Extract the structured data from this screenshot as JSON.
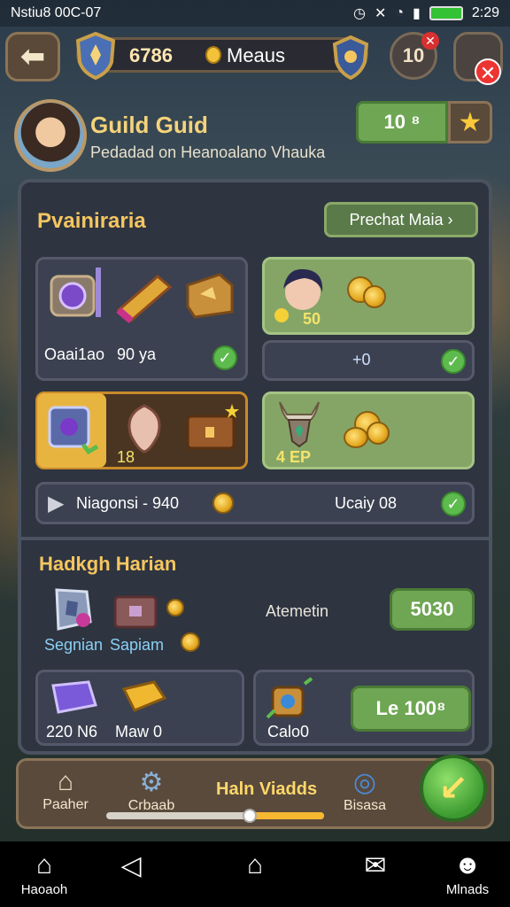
{
  "status_bar": {
    "left_text": "Nstiu8 00C-07",
    "time": "2:29"
  },
  "topbar": {
    "resource_value": "6786",
    "resource_label": "Meaus",
    "level_value": "10"
  },
  "guild": {
    "title": "Guild Guid",
    "subtitle": "Pedadad on Heanoalano Vhauka",
    "amount": "10 ⁸",
    "star_icon": "star-icon"
  },
  "section1": {
    "title": "Pvainiraria",
    "action_button": "Prechat Maia ›",
    "card1": {
      "text_left": "Oaai1ao",
      "text_right": "90 ya"
    },
    "card2": {
      "value": "50"
    },
    "card2b": {
      "value": "+0"
    },
    "card3": {
      "value": "18"
    },
    "card4": {
      "value": "4  EP"
    },
    "row": {
      "label": "Niagonsi - 940",
      "right_text": "Ucaiy 08"
    }
  },
  "section2": {
    "title": "Hadkgh Harian",
    "item1": "Segnian",
    "item2": "Sapiam",
    "mid_label": "Atemetin",
    "value_button": "5030",
    "card_a": {
      "left": "220 N6",
      "right": "Maw 0"
    },
    "card_b": {
      "label": "Calo0",
      "button": "Le 100⁸"
    }
  },
  "dock": {
    "home_label": "Paaher",
    "craft_label": "Crbaab",
    "title": "Haln Viadds",
    "right_label": "Bisasa",
    "slider_percent": 66
  },
  "sysnav": {
    "home_label": "Haoaoh",
    "right_label": "Mlnads"
  },
  "colors": {
    "accent_gold": "#f5c660",
    "button_green": "#6ea653",
    "panel_bg": "#2e3440"
  }
}
